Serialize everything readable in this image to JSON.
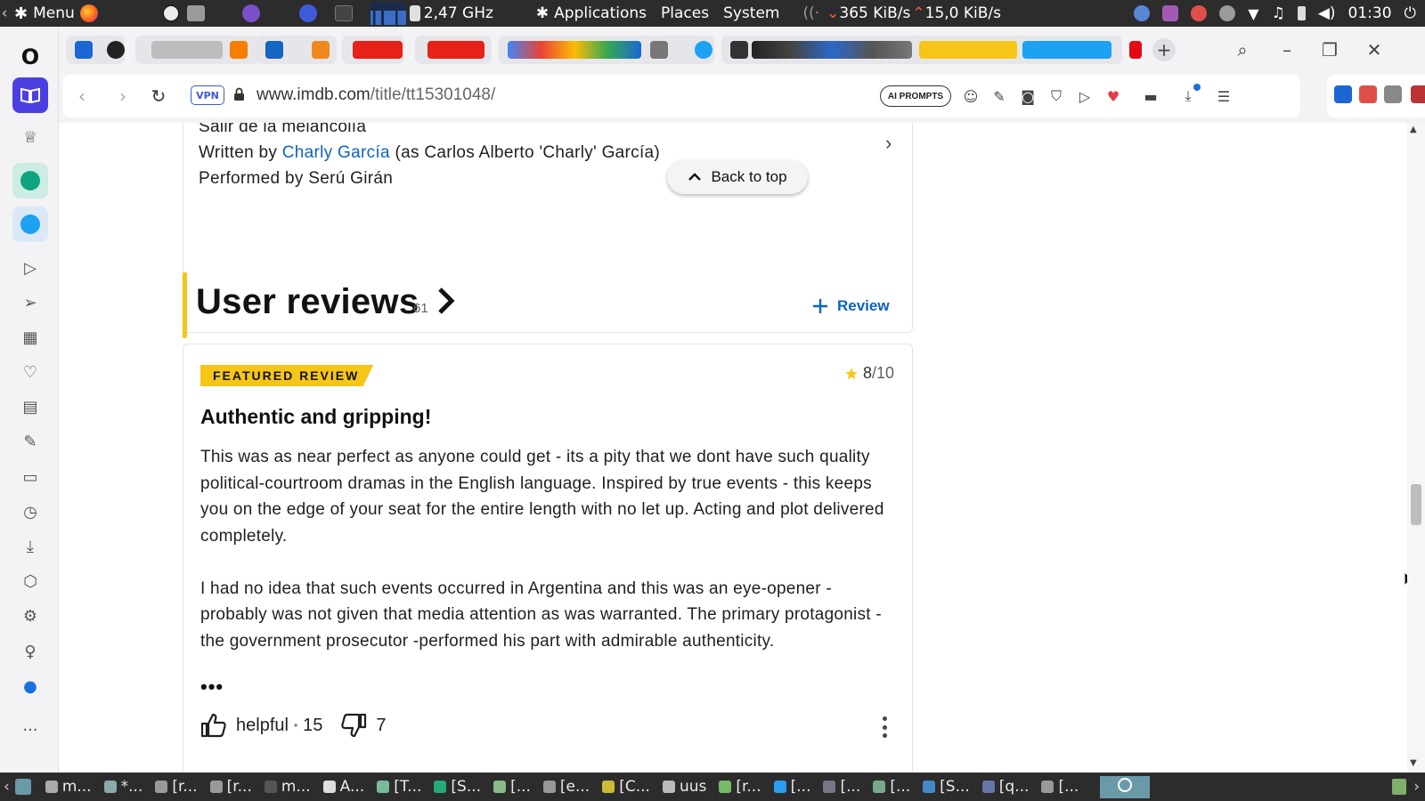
{
  "os_panel": {
    "menu_label": "Menu",
    "cpu_freq": "2,47 GHz",
    "applications": "Applications",
    "places": "Places",
    "system": "System",
    "net_down": "365 KiB/s",
    "net_up": "15,0 KiB/s",
    "clock": "01:30"
  },
  "browser": {
    "url_domain": "www.imdb.com",
    "url_path": "/title/tt15301048/",
    "vpn_label": "VPN",
    "ai_prompts_label": "AI PROMPTS"
  },
  "soundtrack": {
    "song_title": "Salir de la melancolía",
    "written_prefix": "Written by ",
    "writer": "Charly García",
    "writer_suffix": " (as Carlos Alberto 'Charly' García)",
    "performed": "Performed by Serú Girán"
  },
  "back_to_top": "Back to top",
  "user_reviews": {
    "title": "User reviews",
    "count": "61",
    "add_review_label": "Review"
  },
  "featured_review": {
    "badge": "FEATURED REVIEW",
    "rating": "8",
    "rating_max": "/10",
    "title": "Authentic and gripping!",
    "paragraph_1": "This was as near perfect as anyone could get - its a pity that we dont have such quality political-courtroom dramas in the English language. Inspired by true events - this keeps you on the edge of your seat for the entire length with no let up. Acting and plot delivered completely.",
    "paragraph_2": "I had no idea that such events occurred in Argentina and this was an eye-opener - probably was not given that media attention as was warranted. The primary protagonist - the government prosecutor -performed his part with admirable authenticity.",
    "ellipsis": "•••",
    "helpful_label": "helpful",
    "helpful_separator": "•",
    "helpful_count": "15",
    "unhelpful_count": "7"
  },
  "taskbar": {
    "items": [
      "m...",
      "*...",
      "[r...",
      "[r...",
      "m...",
      "A...",
      "[T...",
      "[S...",
      "[...",
      "[e...",
      "[C...",
      "uus",
      "[r...",
      "[...",
      "[...",
      "[...",
      "[S...",
      "[q...",
      "[..."
    ]
  },
  "colors": {
    "imdb_yellow": "#f5c518",
    "link_blue": "#0e63be",
    "browser_accent": "#4b3fe2"
  }
}
